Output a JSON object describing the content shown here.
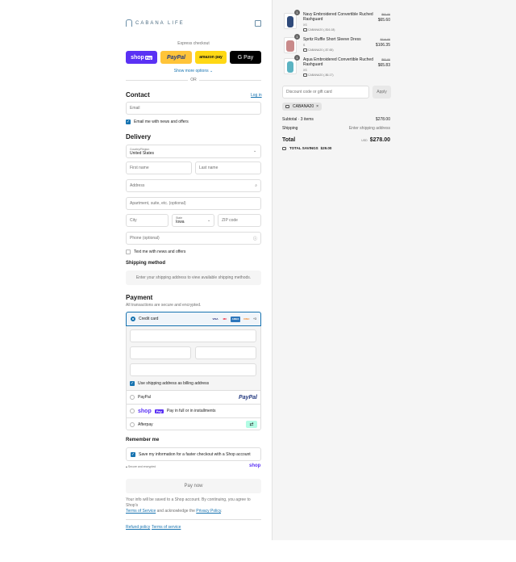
{
  "brand": {
    "name": "CABANA LIFE"
  },
  "express": {
    "label": "Express checkout",
    "shop_pay": "shop",
    "shop_pay_badge": "Pay",
    "paypal": "PayPal",
    "amazon_pay": "amazon pay",
    "gpay": "G Pay",
    "show_more": "Show more options ⌄",
    "or": "OR"
  },
  "contact": {
    "title": "Contact",
    "login": "Log in",
    "email_placeholder": "Email",
    "news_label": "Email me with news and offers"
  },
  "delivery": {
    "title": "Delivery",
    "country_label": "Country/Region",
    "country_value": "United States",
    "first_name": "First name",
    "last_name": "Last name",
    "address": "Address",
    "apartment": "Apartment, suite, etc. (optional)",
    "city": "City",
    "state_label": "State",
    "state_value": "Iowa",
    "zip": "ZIP code",
    "phone": "Phone (optional)",
    "text_label": "Text me with news and offers"
  },
  "shipping": {
    "title": "Shipping method",
    "message": "Enter your shipping address to view available shipping methods."
  },
  "payment": {
    "title": "Payment",
    "subtitle": "All transactions are secure and encrypted.",
    "credit_card": "Credit card",
    "card_logos": [
      "VISA",
      "MC",
      "AMEX",
      "DISC"
    ],
    "more_cards": "+3",
    "billing_label": "Use shipping address as billing address",
    "paypal": "PayPal",
    "paypal_logo": "PayPal",
    "shop_pay": "shop",
    "shop_pay_badge": "Pay",
    "shop_pay_text": "Pay in full or in installments",
    "afterpay": "Afterpay"
  },
  "remember": {
    "title": "Remember me",
    "label": "Save my information for a faster checkout with a Shop account",
    "secure": "Secure and encrypted",
    "shop": "shop"
  },
  "pay_now": "Pay now",
  "legal": {
    "line1": "Your info will be saved to a Shop account. By continuing, you agree to Shop's",
    "tos": "Terms of Service",
    "and": " and acknowledge the ",
    "privacy": "Privacy Policy",
    "period": "."
  },
  "footer": {
    "refund": "Refund policy",
    "terms": "Terms of service"
  },
  "cart": {
    "items": [
      {
        "qty": "1",
        "name": "Navy Embroidered Convertible Ruched Rashguard",
        "variant": "XS",
        "discount": "CABANA20 (-$16.18)",
        "old_price": "$82.00",
        "price": "$65.60",
        "color": "#2f4a7a"
      },
      {
        "qty": "1",
        "name": "Spritz Ruffle Short Sleeve Dress",
        "variant": "S",
        "discount": "CABANA20 (-$7.65)",
        "old_price": "$114.00",
        "price": "$106.35",
        "color": "#c98a8a"
      },
      {
        "qty": "1",
        "name": "Aqua Embroidered Convertible Ruched Rashguard",
        "variant": "XS",
        "discount": "CABANA20 (-$6.17)",
        "old_price": "$82.00",
        "price": "$65.83",
        "color": "#5bb3c2"
      }
    ],
    "discount_placeholder": "Discount code or gift card",
    "apply": "Apply",
    "applied_code": "CABANA20",
    "remove": "×",
    "subtotal_label": "Subtotal · 3 items",
    "subtotal_value": "$278.00",
    "shipping_label": "Shipping",
    "shipping_value": "Enter shipping address",
    "total_label": "Total",
    "currency": "USD",
    "total_value": "$278.00",
    "savings_label": "TOTAL SAVINGS",
    "savings_value": "$29.00"
  }
}
